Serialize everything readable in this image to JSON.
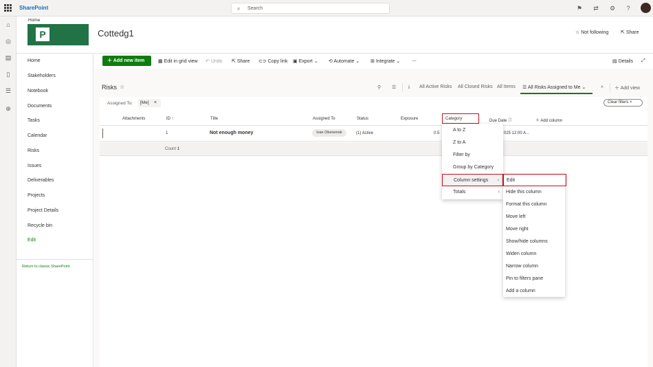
{
  "app": {
    "brand": "SharePoint",
    "search_placeholder": "Search"
  },
  "site": {
    "home_link": "Home",
    "title": "Cottedg1",
    "logo_letter": "P",
    "follow_label": "Not following",
    "share_label": "Share"
  },
  "nav": {
    "items": [
      "Home",
      "Stakeholders",
      "Notebook",
      "Documents",
      "Tasks",
      "Calendar",
      "Risks",
      "Issues",
      "Deliverables",
      "Projects",
      "Project Details",
      "Recycle bin",
      "Edit"
    ],
    "classic_link": "Return to classic SharePoint"
  },
  "commands": {
    "add_new_item": "Add new item",
    "edit_grid": "Edit in grid view",
    "undo": "Undo",
    "share": "Share",
    "copy_link": "Copy link",
    "export": "Export",
    "automate": "Automate",
    "integrate": "Integrate",
    "more": "⋯",
    "details": "Details"
  },
  "list": {
    "title": "Risks",
    "views": [
      "All Active Risks",
      "All Closed Risks",
      "All Items",
      "All Risks Assigned to Me"
    ],
    "add_view": "Add view",
    "filter_label": "Assigned To:",
    "filter_value": "[Me]",
    "clear_filters": "Clear filters",
    "columns": [
      "Attachments",
      "ID ↑",
      "Title",
      "Assigned To",
      "Status",
      "Exposure",
      "Category",
      "Due Date",
      "Add column"
    ],
    "rows": [
      {
        "id": "1",
        "title": "Not enough money",
        "assigned_to": "Ivan Oberemok",
        "status": "(1) Active",
        "exposure": "0.5",
        "due_date": "025 12:00 A..."
      }
    ],
    "count_label": "Count",
    "count_value": "1"
  },
  "column_menu": {
    "items": [
      "A to Z",
      "Z to A",
      "Filter by",
      "Group by Category",
      "Column settings",
      "Totals"
    ],
    "selected": "Column settings"
  },
  "column_settings_menu": {
    "items": [
      "Edit",
      "Hide this column",
      "Format this column",
      "Move left",
      "Move right",
      "Show/hide columns",
      "Widen column",
      "Narrow column",
      "Pin to filters pane",
      "Add a column"
    ],
    "selected": "Edit"
  },
  "colors": {
    "accent": "#107c10",
    "highlight_border": "#c50f1f",
    "brand_blue": "#0f6cbd"
  }
}
